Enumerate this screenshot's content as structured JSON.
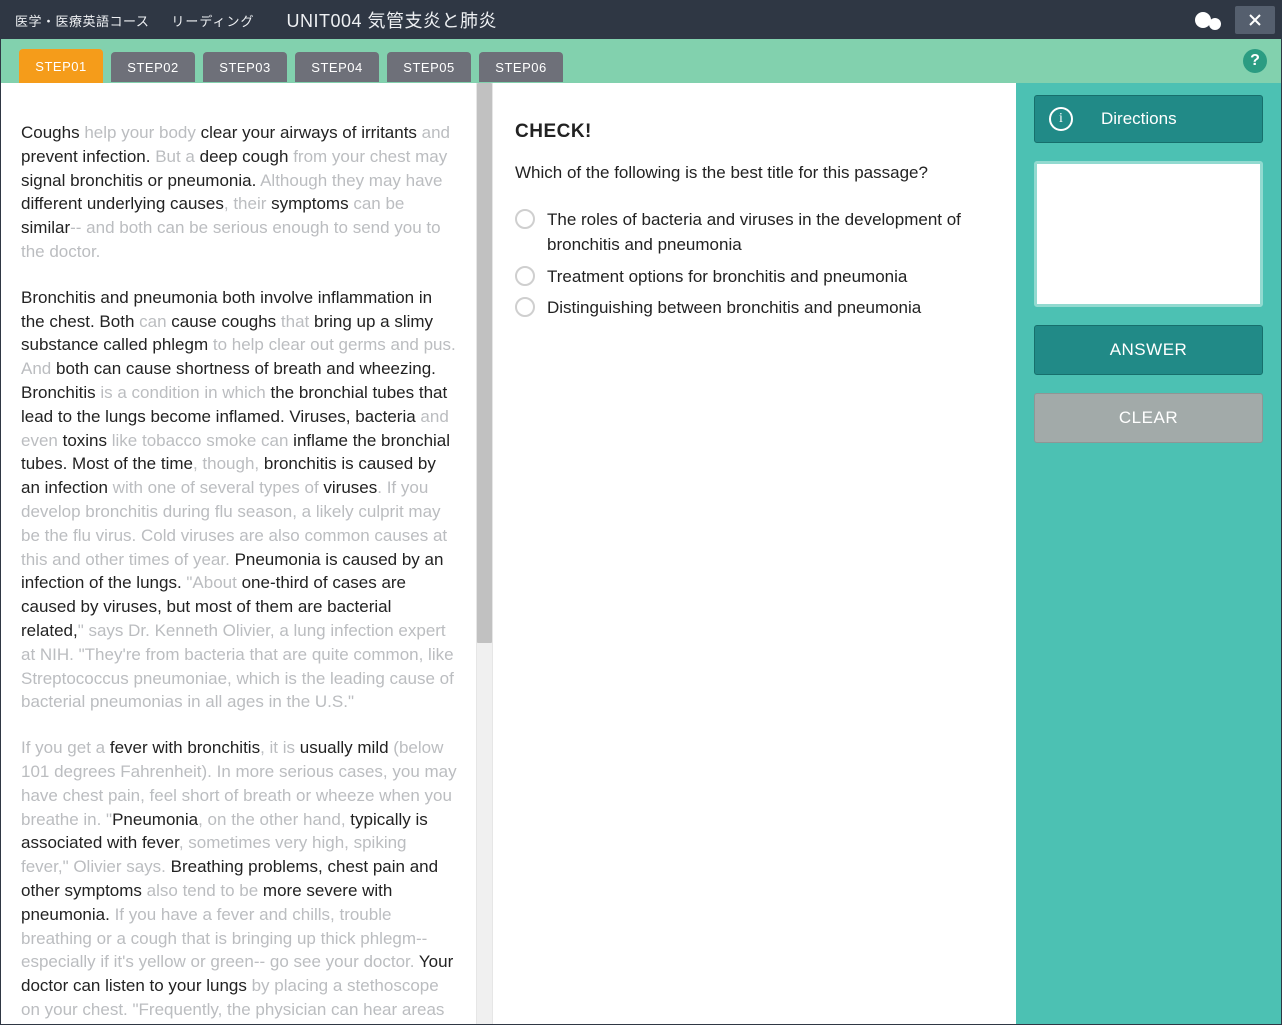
{
  "header": {
    "course": "医学・医療英語コース",
    "section": "リーディング",
    "title": "UNIT004 気管支炎と肺炎",
    "close_tooltip": "Close"
  },
  "steps": [
    "STEP01",
    "STEP02",
    "STEP03",
    "STEP04",
    "STEP05",
    "STEP06"
  ],
  "active_step_index": 0,
  "passage": {
    "spans": [
      {
        "t": "Coughs ",
        "d": false
      },
      {
        "t": "help your body ",
        "d": true
      },
      {
        "t": "clear your airways of irritants",
        "d": false
      },
      {
        "t": " and ",
        "d": true
      },
      {
        "t": "prevent infection.",
        "d": false
      },
      {
        "t": " But a ",
        "d": true
      },
      {
        "t": "deep cough",
        "d": false
      },
      {
        "t": " from your chest may ",
        "d": true
      },
      {
        "t": "signal bronchitis or pneumonia.",
        "d": false
      },
      {
        "t": " Although they may have ",
        "d": true
      },
      {
        "t": "different underlying causes",
        "d": false
      },
      {
        "t": ", their ",
        "d": true
      },
      {
        "t": "symptoms",
        "d": false
      },
      {
        "t": " can be ",
        "d": true
      },
      {
        "t": "similar",
        "d": false
      },
      {
        "t": "-- and both can be serious enough to send you to the doctor.",
        "d": true
      }
    ],
    "para2": [
      {
        "t": "Bronchitis and pneumonia both involve inflammation in the chest. Both ",
        "d": false
      },
      {
        "t": "can ",
        "d": true
      },
      {
        "t": "cause coughs",
        "d": false
      },
      {
        "t": " that ",
        "d": true
      },
      {
        "t": "bring up a slimy substance called phlegm",
        "d": false
      },
      {
        "t": " to help clear out germs and pus. And ",
        "d": true
      },
      {
        "t": "both can cause shortness of breath and wheezing. Bronchitis",
        "d": false
      },
      {
        "t": " is a condition in which ",
        "d": true
      },
      {
        "t": "the bronchial tubes that lead to the lungs become inflamed. Viruses, bacteria",
        "d": false
      },
      {
        "t": " and even ",
        "d": true
      },
      {
        "t": "toxins",
        "d": false
      },
      {
        "t": " like tobacco smoke can ",
        "d": true
      },
      {
        "t": "inflame the bronchial tubes. Most of the time",
        "d": false
      },
      {
        "t": ", though, ",
        "d": true
      },
      {
        "t": "bronchitis is caused by an infection",
        "d": false
      },
      {
        "t": " with one of several types of ",
        "d": true
      },
      {
        "t": "viruses",
        "d": false
      },
      {
        "t": ". If you develop bronchitis during flu season, a likely culprit may be the flu virus. Cold viruses are also common causes at this and other times of year. ",
        "d": true
      },
      {
        "t": "Pneumonia is caused by an infection of the lungs.",
        "d": false
      },
      {
        "t": " \"About ",
        "d": true
      },
      {
        "t": "one-third of cases are caused by viruses, but most of them are bacterial related,",
        "d": false
      },
      {
        "t": "\" says Dr. Kenneth Olivier, a lung infection expert at NIH. \"They're from bacteria that are quite common, like Streptococcus pneumoniae, which is the leading cause of bacterial pneumonias in all ages in the U.S.\"",
        "d": true
      }
    ],
    "para3": [
      {
        "t": "If you get a ",
        "d": true
      },
      {
        "t": "fever with bronchitis",
        "d": false
      },
      {
        "t": ", it is ",
        "d": true
      },
      {
        "t": "usually mild",
        "d": false
      },
      {
        "t": " (below 101 degrees Fahrenheit). In more serious cases, you may have chest pain, feel short of breath or wheeze when you breathe in. \"",
        "d": true
      },
      {
        "t": "Pneumonia",
        "d": false
      },
      {
        "t": ", on the other hand, ",
        "d": true
      },
      {
        "t": "typically is associated with fever",
        "d": false
      },
      {
        "t": ", sometimes very high, spiking fever,\" Olivier says. ",
        "d": true
      },
      {
        "t": "Breathing problems, chest pain and other symptoms",
        "d": false
      },
      {
        "t": " also tend to be ",
        "d": true
      },
      {
        "t": "more severe with pneumonia.",
        "d": false
      },
      {
        "t": " If you have a fever and chills, trouble breathing or a cough that is bringing up thick phlegm--especially if it's yellow or green-- go see your doctor. ",
        "d": true
      },
      {
        "t": "Your doctor can listen to your lungs",
        "d": false
      },
      {
        "t": " by placing a stethoscope on your chest. \"Frequently, the physician can hear areas",
        "d": true
      }
    ]
  },
  "question": {
    "check_label": "CHECK!",
    "prompt": "Which of the following is the best title for this passage?",
    "options": [
      "The roles of bacteria and viruses in the development of bronchitis and pneumonia",
      "Treatment options for bronchitis and pneumonia",
      "Distinguishing between bronchitis and pneumonia"
    ]
  },
  "sidebar": {
    "directions": "Directions",
    "answer": "ANSWER",
    "clear": "CLEAR"
  }
}
